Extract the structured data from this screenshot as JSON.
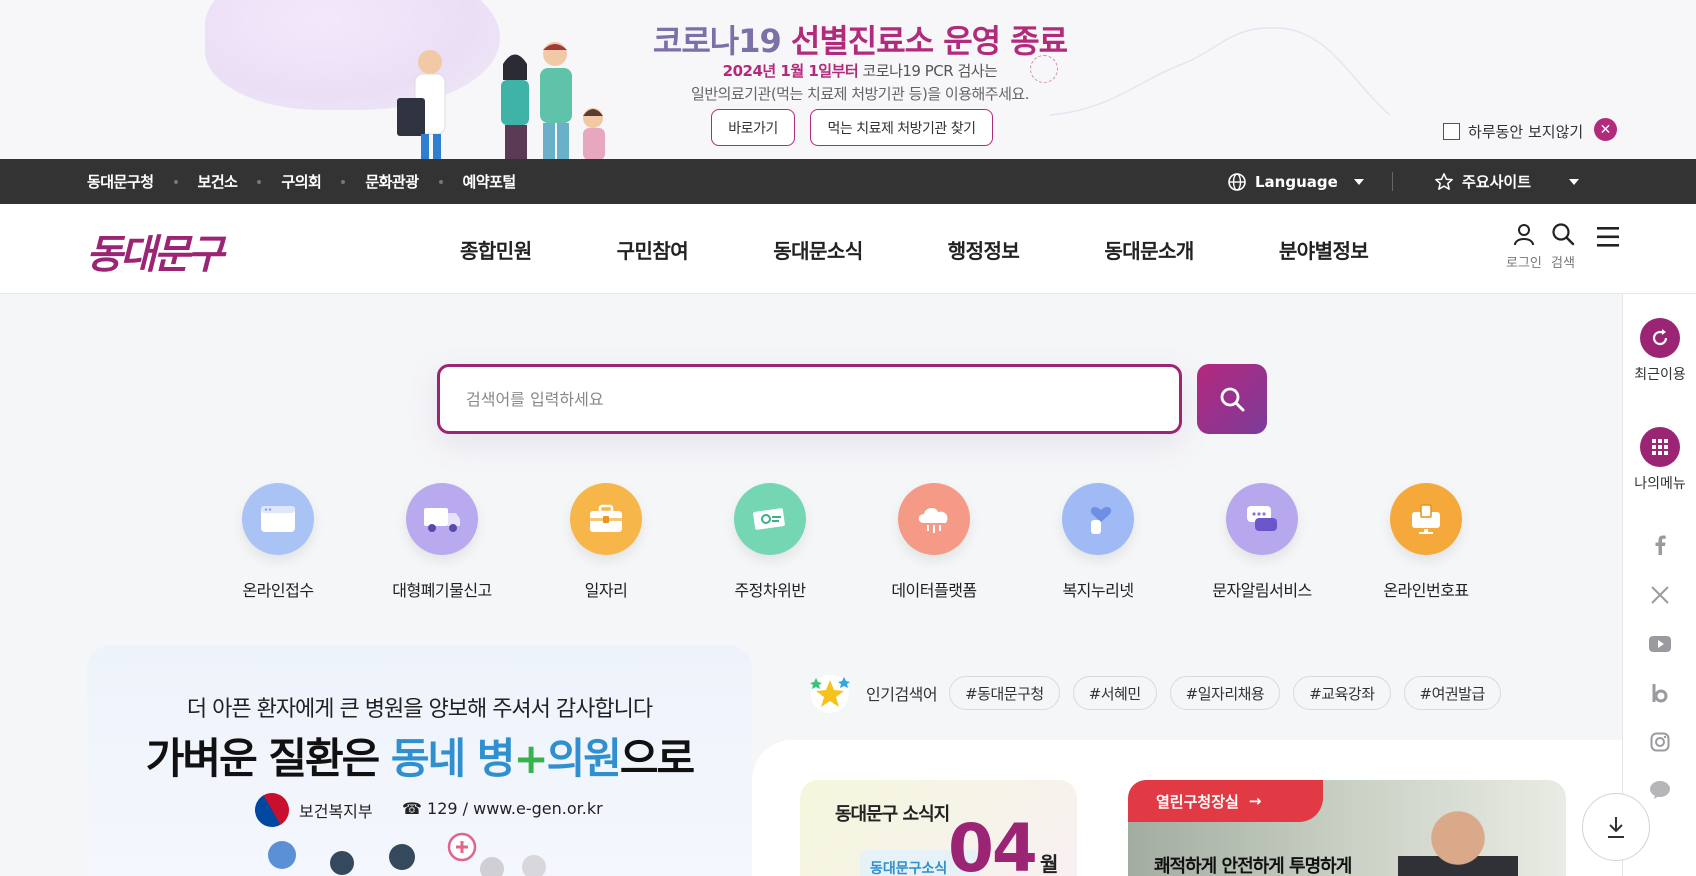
{
  "banner": {
    "title_part1": "코로나19",
    "title_part2": "선별진료소 운영 종료",
    "line1_highlight": "2024년 1월 1일부터",
    "line1_rest": " 코로나19 PCR 검사는",
    "line2": "일반의료기관(먹는 치료제 처방기관 등)을 이용해주세요.",
    "btn_go": "바로가기",
    "btn_find": "먹는 치료제 처방기관 찾기",
    "hide_today": "하루동안 보지않기",
    "close_icon": "close-icon",
    "accent_color": "#b22a7b"
  },
  "utilbar": {
    "links": [
      "동대문구청",
      "보건소",
      "구의회",
      "문화관광",
      "예약포털"
    ],
    "language": "Language",
    "major_sites": "주요사이트",
    "bg_color": "#333333"
  },
  "header": {
    "logo": "동대문구",
    "nav": [
      "종합민원",
      "구민참여",
      "동대문소식",
      "행정정보",
      "동대문소개",
      "분야별정보"
    ],
    "login": "로그인",
    "search": "검색",
    "brand_color": "#9c2474"
  },
  "quickbar": {
    "recent": "최근이용",
    "my_menu": "나의메뉴",
    "sns": [
      "facebook-icon",
      "x-icon",
      "youtube-icon",
      "blog-icon",
      "instagram-icon",
      "kakaotalk-icon"
    ]
  },
  "search": {
    "placeholder": "검색어를 입력하세요"
  },
  "quick_icons": [
    {
      "label": "온라인접수",
      "icon": "browser-window-icon",
      "color": "#a9c3f5"
    },
    {
      "label": "대형폐기물신고",
      "icon": "truck-icon",
      "color": "#b9a9ee"
    },
    {
      "label": "일자리",
      "icon": "briefcase-icon",
      "color": "#f6b64a"
    },
    {
      "label": "주정차위반",
      "icon": "car-ticket-icon",
      "color": "#74d6b3"
    },
    {
      "label": "데이터플랫폼",
      "icon": "cloud-data-icon",
      "color": "#f49a86"
    },
    {
      "label": "복지누리넷",
      "icon": "heart-hand-icon",
      "color": "#9fbaf4"
    },
    {
      "label": "문자알림서비스",
      "icon": "chat-bubble-icon",
      "color": "#b7a8ee"
    },
    {
      "label": "온라인번호표",
      "icon": "kiosk-icon",
      "color": "#f5a93a"
    }
  ],
  "promo": {
    "subtitle": "더 아픈 환자에게 큰 병원을 양보해 주셔서 감사합니다",
    "main_part1": "가벼운 질환은 ",
    "main_part2": "동네 병",
    "main_plus": "+",
    "main_part3": "의원",
    "main_part4": "으로",
    "org": "보건복지부",
    "tel": "☎ 129 / www.e-gen.or.kr"
  },
  "popular": {
    "label": "인기검색어",
    "tags": [
      "#동대문구청",
      "#서혜민",
      "#일자리채용",
      "#교육강좌",
      "#여권발급"
    ]
  },
  "news": {
    "title": "동대문구 소식지",
    "issue": "04",
    "month": "월",
    "mini": "동대문구소식"
  },
  "open_office": {
    "badge": "열린구청장실",
    "arrow": "→",
    "text": "쾌적하게 안전하게 투명하게"
  }
}
